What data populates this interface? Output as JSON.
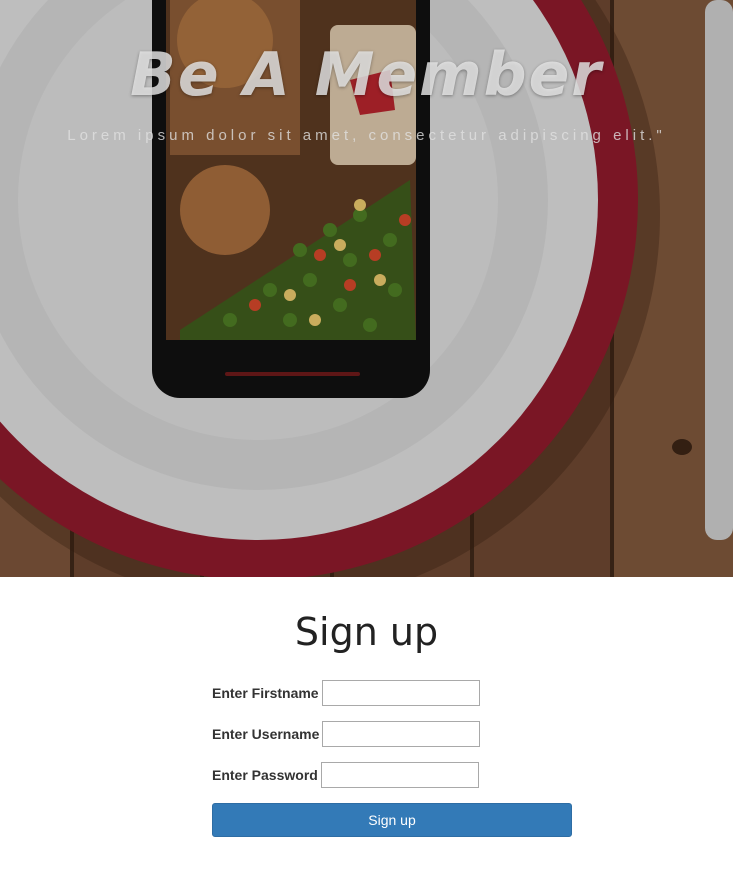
{
  "hero": {
    "title": "Be A Member",
    "tagline": "Lorem ipsum dolor sit amet, consectetur adipiscing elit.\""
  },
  "form": {
    "heading": "Sign up",
    "fields": [
      {
        "label": "Enter Firstname",
        "value": ""
      },
      {
        "label": "Enter Username",
        "value": ""
      },
      {
        "label": "Enter Password",
        "value": ""
      }
    ],
    "submit_label": "Sign up"
  },
  "colors": {
    "button": "#337ab7",
    "plate_rim": "#8b1a2b",
    "wood": "#6e4a32"
  }
}
